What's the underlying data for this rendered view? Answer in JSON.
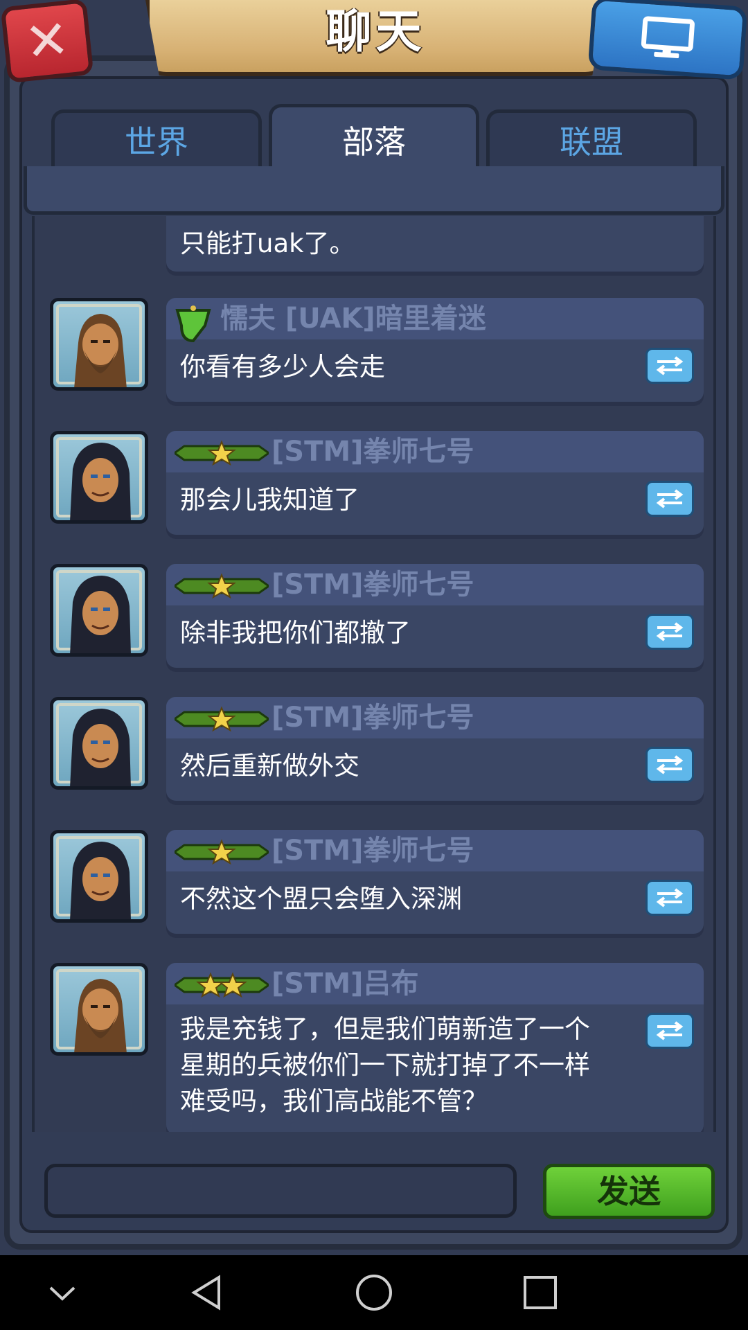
{
  "header": {
    "title": "聊天",
    "close_icon": "close-x-icon",
    "right_icon": "monitor-icon"
  },
  "tabs": [
    {
      "label": "世界",
      "active": false
    },
    {
      "label": "部落",
      "active": true
    },
    {
      "label": "联盟",
      "active": false
    }
  ],
  "messages": [
    {
      "sender": "",
      "text": "只能打uak了。",
      "avatar": "none",
      "rank_stars": 0
    },
    {
      "sender": "懦夫 [UAK]暗里着迷",
      "text": "你看有多少人会走",
      "avatar": "bearded-warrior-avatar",
      "badge": "green-shield-icon"
    },
    {
      "sender": "[STM]拳师七号",
      "text": "那会儿我知道了",
      "avatar": "long-haired-warrior-avatar",
      "rank_stars": 1
    },
    {
      "sender": "[STM]拳师七号",
      "text": "除非我把你们都撤了",
      "avatar": "long-haired-warrior-avatar",
      "rank_stars": 1
    },
    {
      "sender": "[STM]拳师七号",
      "text": "然后重新做外交",
      "avatar": "long-haired-warrior-avatar",
      "rank_stars": 1
    },
    {
      "sender": "[STM]拳师七号",
      "text": "不然这个盟只会堕入深渊",
      "avatar": "long-haired-warrior-avatar",
      "rank_stars": 1
    },
    {
      "sender": "[STM]吕布",
      "text": "我是充钱了，但是我们萌新造了一个\n星期的兵被你们一下就打掉了不一样\n难受吗，我们高战能不管？",
      "avatar": "bearded-warrior-avatar",
      "rank_stars": 2
    }
  ],
  "composer": {
    "input_value": "",
    "send_label": "发送"
  },
  "system_nav": {
    "icons": [
      "chevron-down-icon",
      "back-icon",
      "home-icon",
      "recents-icon"
    ]
  },
  "colors": {
    "background": "#323b53",
    "tab_inactive_text": "#5ca6e4",
    "sender_text": "#7585ad",
    "send_button": "#4fb828",
    "reply_button": "#5fb7ea"
  }
}
